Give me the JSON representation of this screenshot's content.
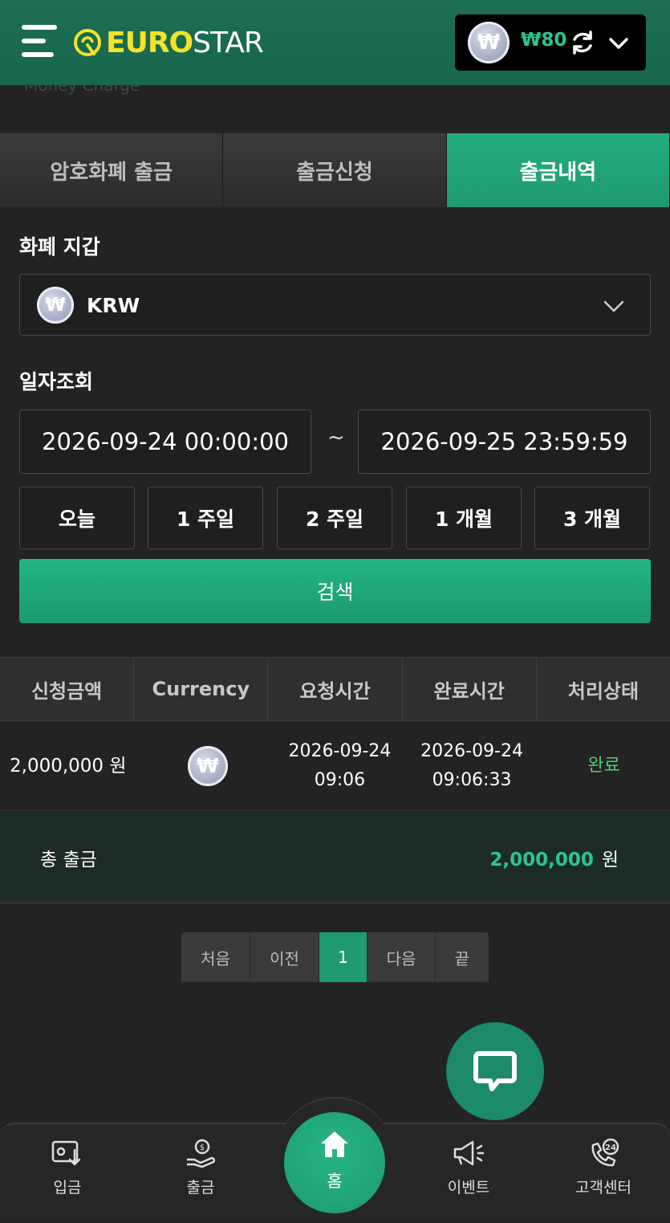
{
  "header": {
    "logo_prefix": "EURO",
    "logo_suffix": "STAR",
    "currency_symbol": "₩",
    "balance": "₩80"
  },
  "peek_title": "Money Charge",
  "tabs": [
    {
      "label": "암호화폐 출금",
      "active": false
    },
    {
      "label": "출금신청",
      "active": false
    },
    {
      "label": "출금내역",
      "active": true
    }
  ],
  "wallet": {
    "label": "화폐 지갑",
    "selected": "KRW"
  },
  "date": {
    "label": "일자조회",
    "from": "2026-09-24 00:00:00",
    "separator": "~",
    "to": "2026-09-25 23:59:59",
    "quick": [
      "오늘",
      "1 주일",
      "2 주일",
      "1 개월",
      "3 개월"
    ]
  },
  "search_label": "검색",
  "table": {
    "headers": [
      "신청금액",
      "Currency",
      "요청시간",
      "완료시간",
      "처리상태"
    ],
    "rows": [
      {
        "amount": "2,000,000 원",
        "currency_symbol": "₩",
        "request_date": "2026-09-24",
        "request_time": "09:06",
        "complete_date": "2026-09-24",
        "complete_time": "09:06:33",
        "status": "완료"
      }
    ]
  },
  "total": {
    "label": "총 출금",
    "value": "2,000,000",
    "unit": "원"
  },
  "pagination": [
    "처음",
    "이전",
    "1",
    "다음",
    "끝"
  ],
  "bottom_nav": {
    "deposit": "입금",
    "withdraw": "출금",
    "home": "홈",
    "event": "이벤트",
    "support": "고객센터",
    "support_badge": "24"
  },
  "colors": {
    "accent": "#1f9a72",
    "header": "#17664d",
    "logo_yellow": "#f3e329",
    "status_done": "#4bd06f"
  }
}
